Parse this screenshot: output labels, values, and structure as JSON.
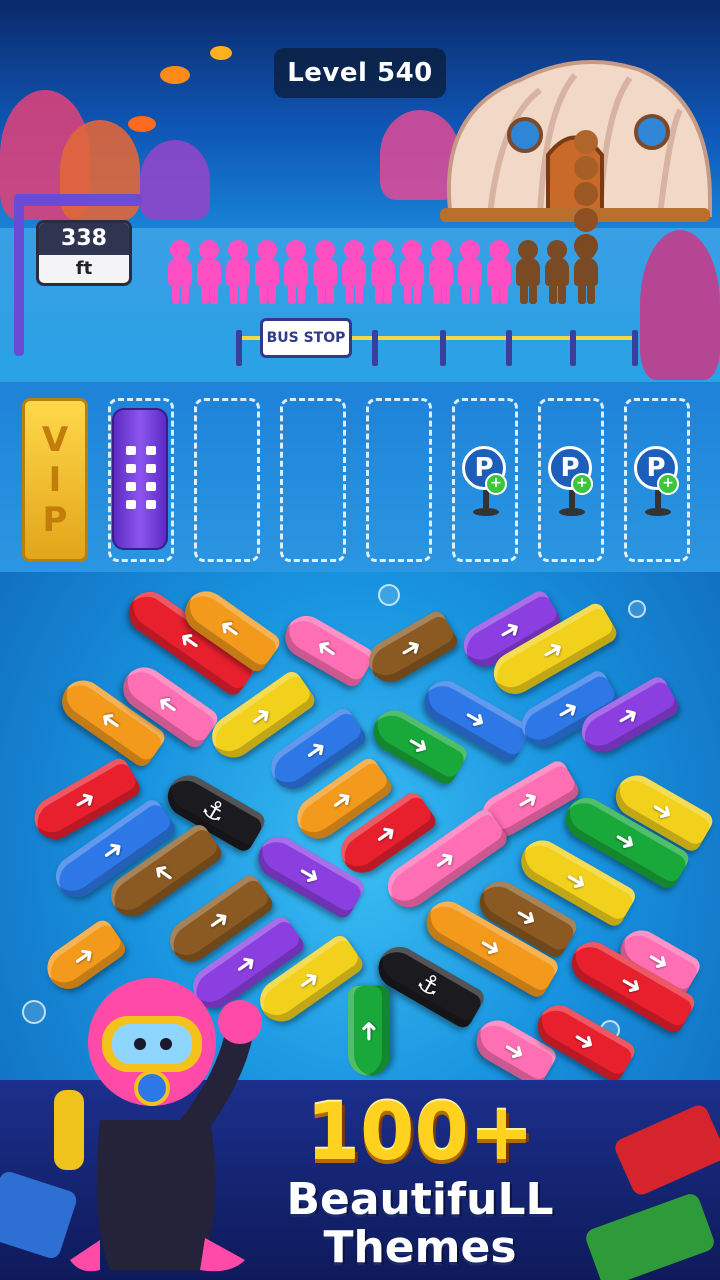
{
  "hud": {
    "level_label": "Level 540",
    "depth_value": "338",
    "depth_unit": "ft"
  },
  "bus_stop_sign": "BUS STOP",
  "queue": {
    "pink_passengers": 12,
    "brown_passengers": 3,
    "colors": {
      "pink": "#ff4fc3",
      "brown": "#7a4a24"
    }
  },
  "parking": {
    "vip_label": "VIP",
    "slot_count": 7,
    "occupied_slots": 1,
    "locked_slots": 3,
    "locked_icon": "P",
    "locked_badge": "+"
  },
  "board": {
    "arrow_glyph": "➜",
    "anchor_glyph": "⚓",
    "colors": {
      "red": "#e8202e",
      "orange": "#f39a1c",
      "pink": "#ff6fb4",
      "brown": "#8a5a22",
      "purple": "#8b3fe0",
      "yellow": "#f2d11c",
      "blue": "#2d78e6",
      "green": "#19a83a",
      "black": "#1b1b1f"
    }
  },
  "promo": {
    "headline": "100+",
    "subline_1": "BeautifuLL",
    "subline_2": "Themes"
  }
}
